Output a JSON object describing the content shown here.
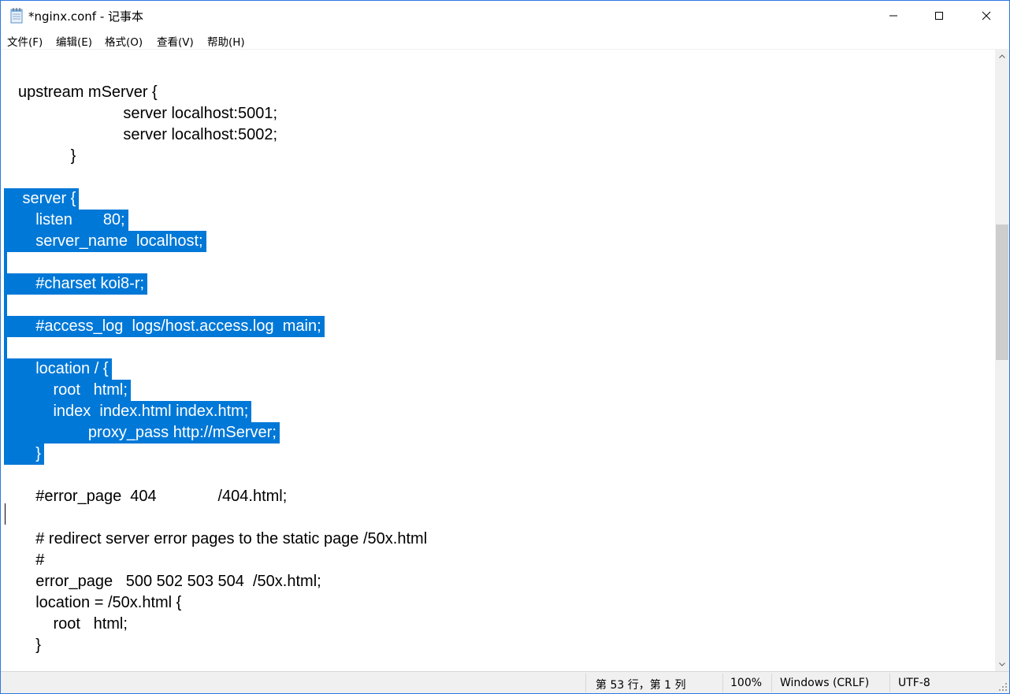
{
  "window": {
    "title": "*nginx.conf - 记事本",
    "accent": "#0078d7"
  },
  "menu": [
    {
      "label": "文件(F)"
    },
    {
      "label": "编辑(E)"
    },
    {
      "label": "格式(O)"
    },
    {
      "label": "查看(V)"
    },
    {
      "label": "帮助(H)"
    }
  ],
  "editor": {
    "lines": [
      {
        "text": "",
        "selected": false
      },
      {
        "text": "upstream mServer {",
        "selected": false
      },
      {
        "text": "                        server localhost:5001;",
        "selected": false
      },
      {
        "text": "                        server localhost:5002;",
        "selected": false
      },
      {
        "text": "            }",
        "selected": false
      },
      {
        "text": "",
        "selected": false
      },
      {
        "text": " server {",
        "selected": true
      },
      {
        "text": "    listen       80;",
        "selected": true
      },
      {
        "text": "    server_name  localhost;",
        "selected": true
      },
      {
        "text": "",
        "selected": true
      },
      {
        "text": "    #charset koi8-r;",
        "selected": true
      },
      {
        "text": "",
        "selected": true
      },
      {
        "text": "    #access_log  logs/host.access.log  main;",
        "selected": true
      },
      {
        "text": "",
        "selected": true
      },
      {
        "text": "    location / {",
        "selected": true
      },
      {
        "text": "        root   html;",
        "selected": true
      },
      {
        "text": "        index  index.html index.htm;",
        "selected": true
      },
      {
        "text": "                proxy_pass http://mServer;",
        "selected": true
      },
      {
        "text": "    }",
        "selected": true
      },
      {
        "text": "",
        "selected": false
      },
      {
        "text": "    #error_page  404              /404.html;",
        "selected": false
      },
      {
        "text": "",
        "selected": false
      },
      {
        "text": "    # redirect server error pages to the static page /50x.html",
        "selected": false
      },
      {
        "text": "    #",
        "selected": false
      },
      {
        "text": "    error_page   500 502 503 504  /50x.html;",
        "selected": false
      },
      {
        "text": "    location = /50x.html {",
        "selected": false
      },
      {
        "text": "        root   html;",
        "selected": false
      },
      {
        "text": "    }",
        "selected": false
      }
    ]
  },
  "status": {
    "position": "第 53 行，第 1 列",
    "zoom": "100%",
    "line_ending": "Windows (CRLF)",
    "encoding": "UTF-8"
  }
}
